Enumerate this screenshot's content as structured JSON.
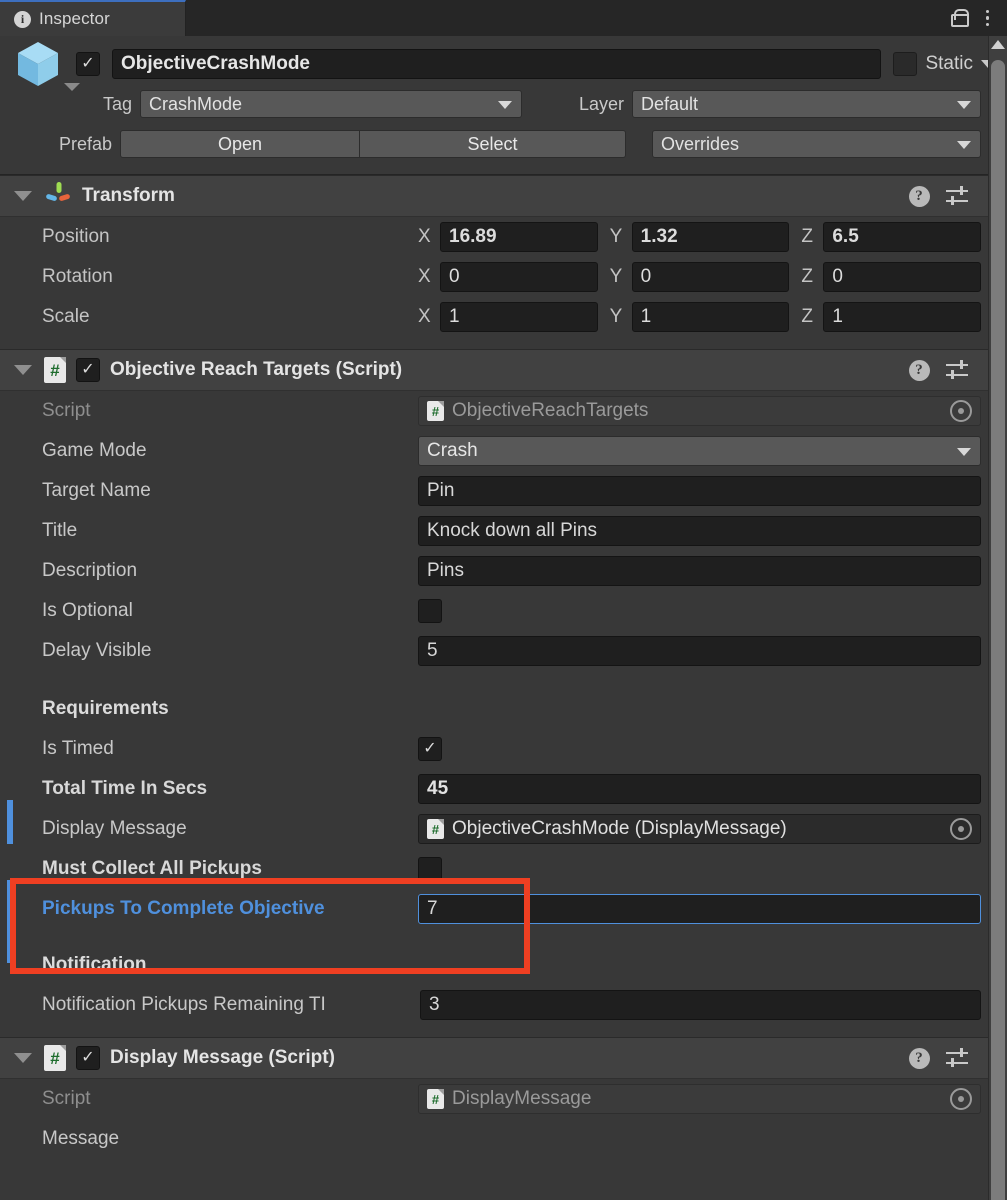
{
  "window": {
    "tab_label": "Inspector",
    "info_icon": "info-icon",
    "lock_icon": "lock-icon",
    "menu_icon": "kebab-menu-icon"
  },
  "object_header": {
    "icon": "cube-icon",
    "enabled_checkbox": "✓",
    "name": "ObjectiveCrashMode",
    "static_label": "Static",
    "static_checked": false,
    "tag_label": "Tag",
    "tag_value": "CrashMode",
    "layer_label": "Layer",
    "layer_value": "Default",
    "prefab_label": "Prefab",
    "open_button": "Open",
    "select_button": "Select",
    "overrides_button": "Overrides"
  },
  "transform": {
    "title": "Transform",
    "icon": "transform-axis-icon",
    "help_icon": "help-icon",
    "preset_icon": "preset-settings-icon",
    "menu_icon": "kebab-menu-icon",
    "rows": [
      {
        "label": "Position",
        "bold": true,
        "x": "16.89",
        "y": "1.32",
        "z": "6.5"
      },
      {
        "label": "Rotation",
        "bold": true,
        "x": "0",
        "y": "0",
        "z": "0"
      },
      {
        "label": "Scale",
        "bold": false,
        "x": "1",
        "y": "1",
        "z": "1"
      }
    ],
    "axis_x": "X",
    "axis_y": "Y",
    "axis_z": "Z"
  },
  "objective_script": {
    "title": "Objective Reach Targets (Script)",
    "icon": "csharp-script-icon",
    "enabled": true,
    "script_label": "Script",
    "script_value": "ObjectiveReachTargets",
    "game_mode_label": "Game Mode",
    "game_mode_value": "Crash",
    "target_name_label": "Target Name",
    "target_name_value": "Pin",
    "title_label": "Title",
    "title_value": "Knock down all Pins",
    "description_label": "Description",
    "description_value": "Pins",
    "is_optional_label": "Is Optional",
    "is_optional_checked": false,
    "delay_visible_label": "Delay Visible",
    "delay_visible_value": "5",
    "requirements_header": "Requirements",
    "is_timed_label": "Is Timed",
    "is_timed_checked": true,
    "total_time_label": "Total Time In Secs",
    "total_time_value": "45",
    "display_message_label": "Display Message",
    "display_message_value": "ObjectiveCrashMode (DisplayMessage)",
    "must_collect_label": "Must Collect All Pickups",
    "must_collect_checked": false,
    "pickups_to_complete_label": "Pickups To Complete Objective",
    "pickups_to_complete_value": "7",
    "notification_header": "Notification",
    "notification_pickups_label": "Notification Pickups Remaining TI",
    "notification_pickups_value": "3"
  },
  "display_message_script": {
    "title": "Display Message (Script)",
    "icon": "csharp-script-icon",
    "enabled": true,
    "script_label": "Script",
    "script_value": "DisplayMessage",
    "message_label": "Message"
  },
  "colors": {
    "accent_blue": "#4f90dd",
    "highlight_red": "#ef3f22",
    "panel_bg": "#383838",
    "header_bg": "#414141"
  }
}
